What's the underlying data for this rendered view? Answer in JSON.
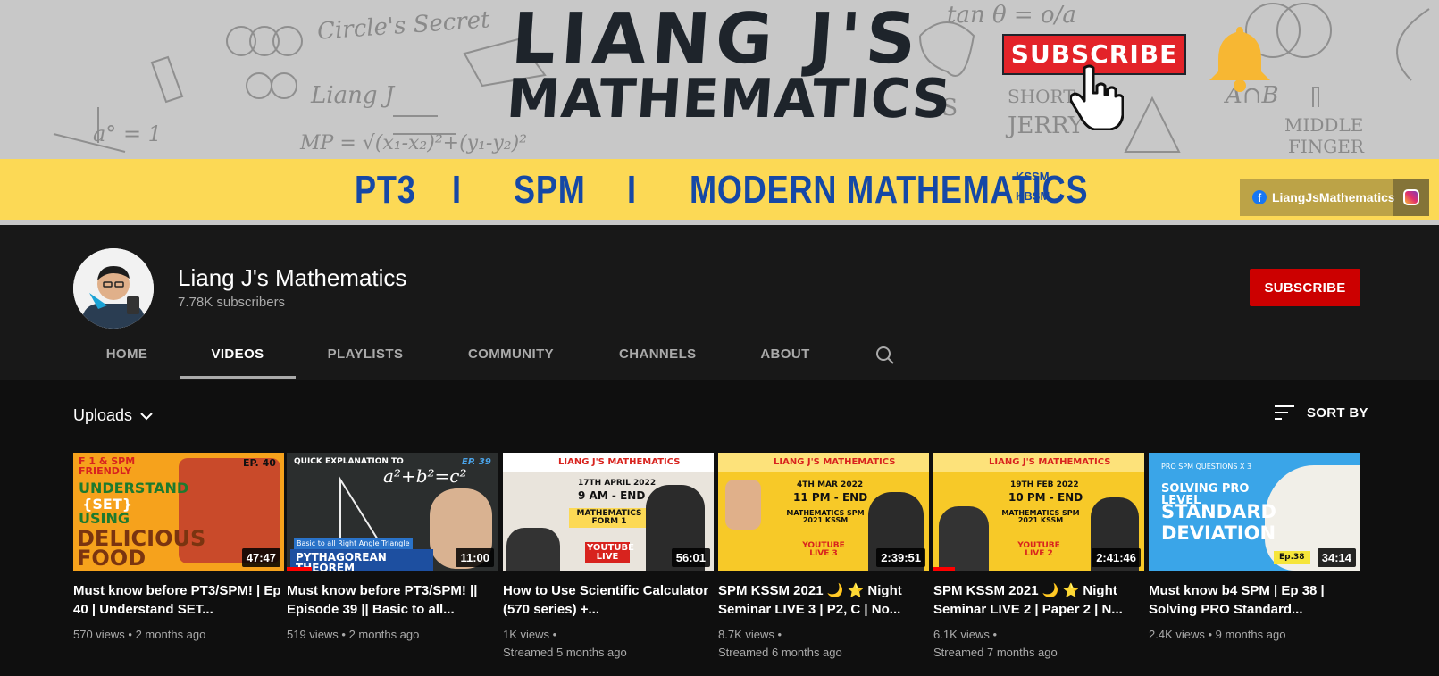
{
  "banner": {
    "title_line1": "LIANG J'S",
    "title_line2": "MATHEMATICS",
    "subscribe_graphic": "SUBSCRIBE",
    "strip_items": [
      "PT3",
      "I",
      "SPM",
      "I",
      "MODERN MATHEMATICS"
    ],
    "strip_small_top": "KSSM",
    "strip_small_bottom": "KBSM",
    "doodles": [
      "Circle's Secret",
      "Liang J",
      "tan θ = o/a",
      "A∩B",
      "MIDDLE",
      "FINGER",
      "JERRY",
      "iS",
      "MP = √(x₁-x₂)²+(y₁-y₂)²",
      "a° = 1",
      "SHORT"
    ],
    "social_handle": "LiangJsMathematics"
  },
  "channel": {
    "name": "Liang J's Mathematics",
    "subscribers": "7.78K subscribers",
    "subscribe_label": "SUBSCRIBE"
  },
  "tabs": [
    {
      "label": "HOME"
    },
    {
      "label": "VIDEOS"
    },
    {
      "label": "PLAYLISTS"
    },
    {
      "label": "COMMUNITY"
    },
    {
      "label": "CHANNELS"
    },
    {
      "label": "ABOUT"
    }
  ],
  "active_tab": "VIDEOS",
  "content": {
    "uploads_label": "Uploads",
    "sort_label": "SORT BY"
  },
  "videos": [
    {
      "title": "Must know before PT3/SPM! | Ep 40 | Understand SET...",
      "views": "570 views",
      "age": "2 months ago",
      "duration": "47:47",
      "progress": 0,
      "thumb_text": [
        "F 1 & SPM FRIENDLY",
        "UNDERSTAND",
        "{SET}",
        "USING",
        "DELICIOUS",
        "FOOD",
        "EP. 40"
      ]
    },
    {
      "title": "Must know before PT3/SPM! || Episode 39 || Basic to all...",
      "views": "519 views",
      "age": "2 months ago",
      "duration": "11:00",
      "progress": 0.12,
      "thumb_text": [
        "QUICK EXPLANATION TO",
        "a²+b²=c²",
        "EP. 39",
        "Basic to all Right Angle Triangle",
        "PYTHAGOREAN THEOREM"
      ]
    },
    {
      "title": "How to Use Scientific Calculator (570 series) +...",
      "views": "1K views",
      "age": "Streamed 5 months ago",
      "duration": "56:01",
      "progress": 0,
      "thumb_text": [
        "LIANG J'S MATHEMATICS",
        "17TH APRIL 2022",
        "9 AM - END",
        "MATHEMATICS FORM 1",
        "YOUTUBE LIVE"
      ]
    },
    {
      "title": "SPM KSSM 2021 🌙 ⭐ Night Seminar LIVE 3 | P2, C | No...",
      "views": "8.7K views",
      "age": "Streamed 6 months ago",
      "duration": "2:39:51",
      "progress": 0,
      "thumb_text": [
        "LIANG J'S MATHEMATICS",
        "4TH MAR 2022",
        "11 PM - END",
        "MATHEMATICS SPM 2021 KSSM",
        "YOUTUBE LIVE 3"
      ]
    },
    {
      "title": "SPM KSSM 2021 🌙 ⭐ Night Seminar LIVE 2 | Paper 2 | N...",
      "views": "6.1K views",
      "age": "Streamed 7 months ago",
      "duration": "2:41:46",
      "progress": 0.1,
      "thumb_text": [
        "LIANG J'S MATHEMATICS",
        "19TH FEB 2022",
        "10 PM - END",
        "MATHEMATICS SPM 2021 KSSM",
        "YOUTUBE LIVE 2"
      ]
    },
    {
      "title": "Must know b4 SPM | Ep 38 | Solving PRO Standard...",
      "views": "2.4K views",
      "age": "9 months ago",
      "duration": "34:14",
      "progress": 0,
      "thumb_text": [
        "PRO SPM QUESTIONS X 3",
        "SOLVING PRO LEVEL",
        "STANDARD",
        "DEVIATION",
        "Ep.38"
      ]
    }
  ],
  "colors": {
    "banner_bg": "#c8c8c8",
    "banner_strip": "#fcd955",
    "strip_text": "#1548a6",
    "subscribe_red": "#cc0000",
    "header_bg": "#181818",
    "page_bg": "#0f0f0f"
  },
  "icons": [
    "chevron-down-icon",
    "search-icon",
    "sort-icon",
    "facebook-icon",
    "instagram-icon",
    "bell-icon",
    "hand-cursor-icon"
  ]
}
